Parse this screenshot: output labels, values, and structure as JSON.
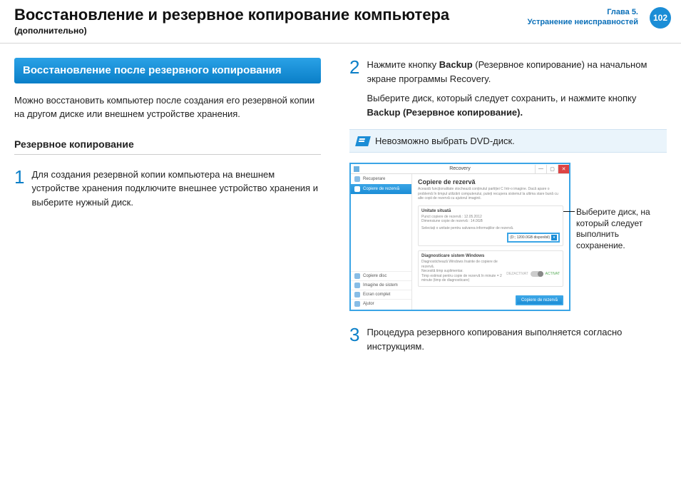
{
  "header": {
    "title": "Восстановление и резервное копирование компьютера",
    "subtitle": "(дополнительно)",
    "chapter_line1": "Глава 5.",
    "chapter_line2": "Устранение неисправностей",
    "page_number": "102"
  },
  "left": {
    "blue_heading": "Восстановление после резервного копирования",
    "intro": "Можно восстановить компьютер после создания его резервной копии на другом диске или внешнем устройстве хранения.",
    "section_heading": "Резервное копирование",
    "step1_num": "1",
    "step1_text": "Для создания резервной копии компьютера на внешнем устройстве хранения подключите внешнее устройство хранения и выберите нужный диск."
  },
  "right": {
    "step2_num": "2",
    "step2_text_before": "Нажмите кнопку ",
    "step2_bold1": "Backup",
    "step2_text_mid": " (Резервное копирование) на начальном экране программы Recovery.",
    "step2_line2_before": "Выберите диск, который следует сохранить, и нажмите кнопку ",
    "step2_bold2": "Backup (Резервное копирование).",
    "note_text": "Невозможно выбрать DVD-диск.",
    "callout": "Выберите диск, на который следует выполнить сохранение.",
    "step3_num": "3",
    "step3_text": "Процедура резервного копирования выполняется согласно инструкциям."
  },
  "mock": {
    "window_title": "Recovery",
    "side_item1": "Recuperare",
    "side_item2": "Copiere de rezervă",
    "side_b1": "Copiere disc",
    "side_b2": "Imagine de sistem",
    "side_b3": "Ecran complet",
    "side_b4": "Ajutor",
    "main_title": "Copiere de rezervă",
    "main_desc": "Această funcționalitate stochează conținutul partiției C într-o imagine. Dacă apare o problemă în timpul utilizării computerului, puteți recupera sistemul la ultima stare bună cu alte copii de rezervă cu ajutorul imaginii.",
    "panel1_h": "Unitate situată",
    "panel1_l1": "Punct copiere de rezervă : 12.05.2012",
    "panel1_l2": "Dimensiune copie de rezervă : 14.0GB",
    "panel1_l3": "Selectați o unitate pentru salvarea informațiilor de rezervă.",
    "drive": "(D:; 1200.0GB disponibil)",
    "panel2_h": "Diagnosticare sistem Windows",
    "panel2_l1": "Diagnostichează Windows înainte de copiere de rezervă.",
    "panel2_l2": "Necesită timp suplimentar.",
    "panel2_l3": "Timp estimat pentru copie de rezervă în minute = 2 minute (timp de diagnosticare)",
    "toggle_off": "DEZACTIVAT",
    "toggle_on": "ACTIVAT",
    "button": "Copiere de rezervă"
  }
}
